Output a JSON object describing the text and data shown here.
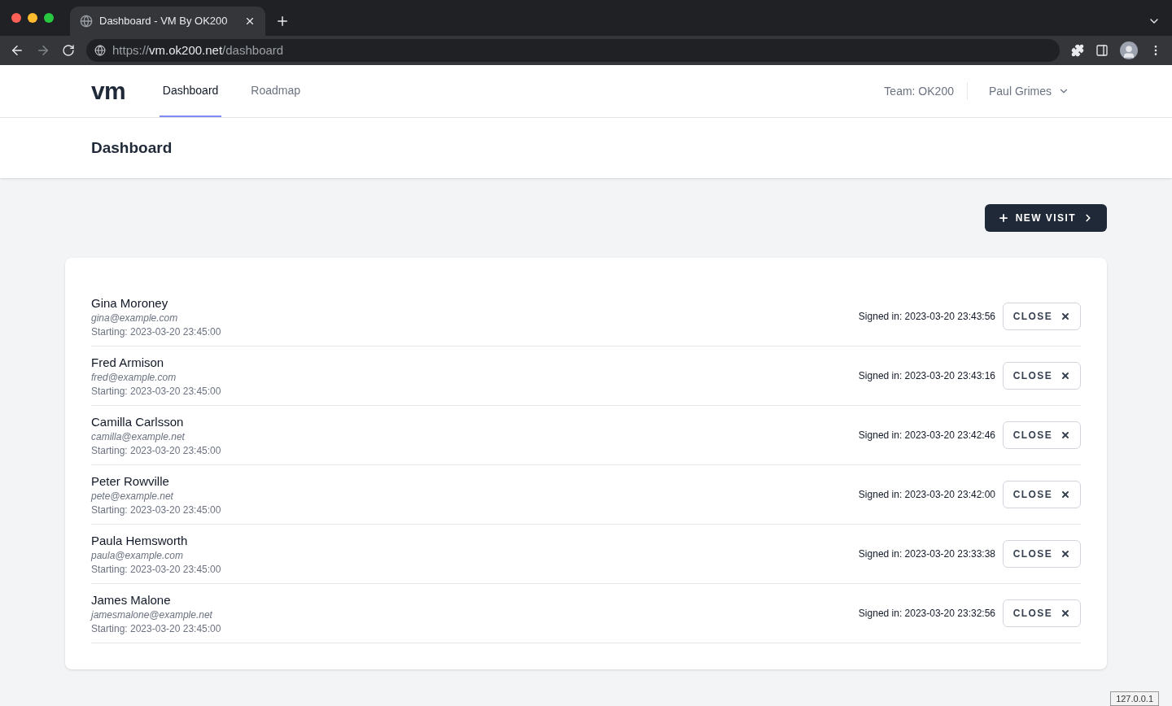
{
  "browser": {
    "tab_title": "Dashboard - VM By OK200",
    "url_scheme": "https://",
    "url_host": "vm.ok200.net",
    "url_path": "/dashboard"
  },
  "nav": {
    "logo": "vm",
    "links": [
      {
        "label": "Dashboard",
        "selected": true
      },
      {
        "label": "Roadmap",
        "selected": false
      }
    ],
    "team": "Team: OK200",
    "user": "Paul Grimes"
  },
  "page_title": "Dashboard",
  "new_visit_button": "NEW VISIT",
  "visits": [
    {
      "name": "Gina Moroney",
      "email": "gina@example.com",
      "starting": "Starting: 2023-03-20 23:45:00",
      "signed_in": "Signed in: 2023-03-20 23:43:56",
      "action": "CLOSE"
    },
    {
      "name": "Fred Armison",
      "email": "fred@example.com",
      "starting": "Starting: 2023-03-20 23:45:00",
      "signed_in": "Signed in: 2023-03-20 23:43:16",
      "action": "CLOSE"
    },
    {
      "name": "Camilla Carlsson",
      "email": "camilla@example.net",
      "starting": "Starting: 2023-03-20 23:45:00",
      "signed_in": "Signed in: 2023-03-20 23:42:46",
      "action": "CLOSE"
    },
    {
      "name": "Peter Rowville",
      "email": "pete@example.net",
      "starting": "Starting: 2023-03-20 23:45:00",
      "signed_in": "Signed in: 2023-03-20 23:42:00",
      "action": "CLOSE"
    },
    {
      "name": "Paula Hemsworth",
      "email": "paula@example.com",
      "starting": "Starting: 2023-03-20 23:45:00",
      "signed_in": "Signed in: 2023-03-20 23:33:38",
      "action": "CLOSE"
    },
    {
      "name": "James Malone",
      "email": "jamesmalone@example.net",
      "starting": "Starting: 2023-03-20 23:45:00",
      "signed_in": "Signed in: 2023-03-20 23:32:56",
      "action": "CLOSE"
    }
  ],
  "host_badge": "127.0.0.1"
}
